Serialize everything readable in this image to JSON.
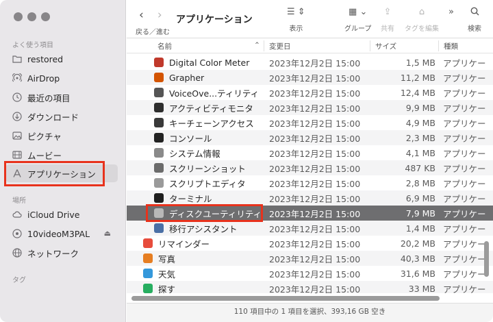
{
  "sidebar": {
    "favorites_label": "よく使う項目",
    "locations_label": "場所",
    "tags_label": "タグ",
    "favorites": [
      {
        "label": "restored",
        "icon": "folder-icon"
      },
      {
        "label": "AirDrop",
        "icon": "airdrop-icon"
      },
      {
        "label": "最近の項目",
        "icon": "clock-icon"
      },
      {
        "label": "ダウンロード",
        "icon": "download-icon"
      },
      {
        "label": "ピクチャ",
        "icon": "picture-icon"
      },
      {
        "label": "ムービー",
        "icon": "film-icon"
      },
      {
        "label": "アプリケーション",
        "icon": "applications-icon"
      }
    ],
    "locations": [
      {
        "label": "iCloud Drive",
        "icon": "cloud-icon"
      },
      {
        "label": "10videoM3PAL",
        "icon": "disk-icon"
      },
      {
        "label": "ネットワーク",
        "icon": "globe-icon"
      }
    ]
  },
  "toolbar": {
    "back_forward_label": "戻る／進む",
    "title": "アプリケーション",
    "view_label": "表示",
    "group_label": "グループ",
    "share_label": "共有",
    "tags_label": "タグを編集",
    "search_label": "検索"
  },
  "columns": {
    "name": "名前",
    "modified": "変更日",
    "size": "サイズ",
    "kind": "種類"
  },
  "rows": [
    {
      "name": "Digital Color Meter",
      "date": "2023年12月2日 15:00",
      "size": "1,5 MB",
      "kind": "アプリケー",
      "icon_color": "#c0392b",
      "indent": true
    },
    {
      "name": "Grapher",
      "date": "2023年12月2日 15:00",
      "size": "11,2 MB",
      "kind": "アプリケー",
      "icon_color": "#d35400",
      "indent": true
    },
    {
      "name": "VoiceOve...ティリティ",
      "date": "2023年12月2日 15:00",
      "size": "12,4 MB",
      "kind": "アプリケー",
      "icon_color": "#555555",
      "indent": true
    },
    {
      "name": "アクティビティモニタ",
      "date": "2023年12月2日 15:00",
      "size": "9,9 MB",
      "kind": "アプリケー",
      "icon_color": "#2d2d2d",
      "indent": true
    },
    {
      "name": "キーチェーンアクセス",
      "date": "2023年12月2日 15:00",
      "size": "4,9 MB",
      "kind": "アプリケー",
      "icon_color": "#3a3a3a",
      "indent": true
    },
    {
      "name": "コンソール",
      "date": "2023年12月2日 15:00",
      "size": "2,3 MB",
      "kind": "アプリケー",
      "icon_color": "#222222",
      "indent": true
    },
    {
      "name": "システム情報",
      "date": "2023年12月2日 15:00",
      "size": "4,1 MB",
      "kind": "アプリケー",
      "icon_color": "#8a8a8a",
      "indent": true
    },
    {
      "name": "スクリーンショット",
      "date": "2023年12月2日 15:00",
      "size": "487 KB",
      "kind": "アプリケー",
      "icon_color": "#6b6b6b",
      "indent": true
    },
    {
      "name": "スクリプトエディタ",
      "date": "2023年12月2日 15:00",
      "size": "2,8 MB",
      "kind": "アプリケー",
      "icon_color": "#9a9a9a",
      "indent": true
    },
    {
      "name": "ターミナル",
      "date": "2023年12月2日 15:00",
      "size": "6,9 MB",
      "kind": "アプリケー",
      "icon_color": "#1e1e1e",
      "indent": true
    },
    {
      "name": "ディスクユーティリティ",
      "date": "2023年12月2日 15:00",
      "size": "7,9 MB",
      "kind": "アプリケー",
      "icon_color": "#b8b8b8",
      "indent": true,
      "selected": true
    },
    {
      "name": "移行アシスタント",
      "date": "2023年12月2日 15:00",
      "size": "1,4 MB",
      "kind": "アプリケー",
      "icon_color": "#4a6fa5",
      "indent": true
    },
    {
      "name": "リマインダー",
      "date": "2023年12月2日 15:00",
      "size": "20,2 MB",
      "kind": "アプリケー",
      "icon_color": "#e74c3c",
      "indent": false
    },
    {
      "name": "写真",
      "date": "2023年12月2日 15:00",
      "size": "40,3 MB",
      "kind": "アプリケー",
      "icon_color": "#e67e22",
      "indent": false
    },
    {
      "name": "天気",
      "date": "2023年12月2日 15:00",
      "size": "31,6 MB",
      "kind": "アプリケー",
      "icon_color": "#3498db",
      "indent": false
    },
    {
      "name": "探す",
      "date": "2023年12月2日 15:00",
      "size": "33 MB",
      "kind": "アプリケー",
      "icon_color": "#27ae60",
      "indent": false
    }
  ],
  "status": "110 項目中の 1 項目を選択、393,16 GB 空き"
}
